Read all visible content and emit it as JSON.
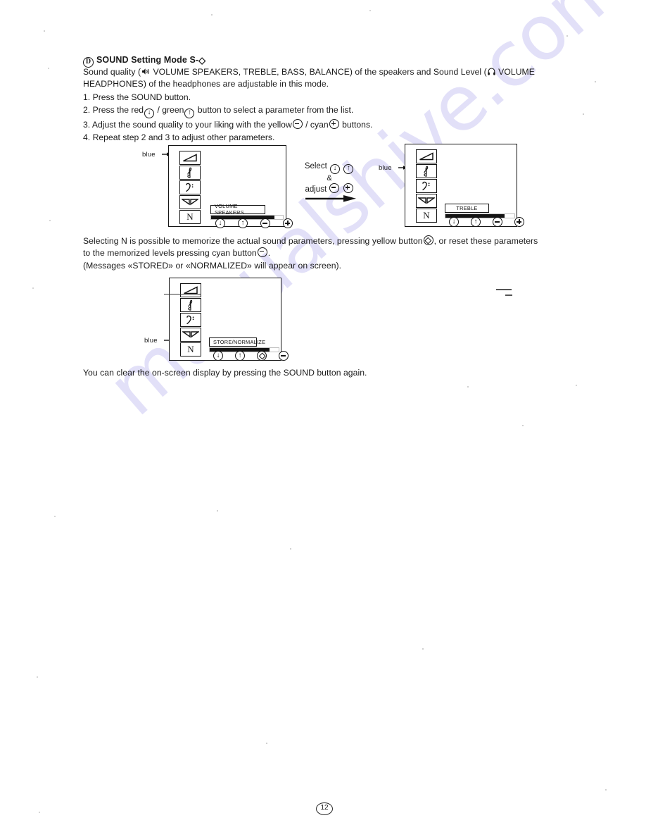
{
  "document": {
    "page_number": "12",
    "watermark": "manualshive.com"
  },
  "heading": {
    "marker": "D",
    "text": "SOUND Setting Mode S-",
    "suffix_icon": "◇"
  },
  "intro": {
    "line1_a": "Sound quality (",
    "speaker_icon": "speaker-icon",
    "line1_b": "VOLUME SPEAKERS, TREBLE, BASS, BALANCE) of the speakers and Sound Level (",
    "headphone_icon": "headphone-icon",
    "line1_c": "VOLUME",
    "line2": "HEADPHONES) of the headphones are adjustable in this mode."
  },
  "steps": [
    {
      "num": "1.",
      "a": "Press the SOUND button.",
      "b": "",
      "c": "",
      "icons": []
    },
    {
      "num": "2.",
      "a": "Press the red",
      "b": "/ green",
      "c": "button to select a parameter from the list."
    },
    {
      "num": "3.",
      "a": "Adjust the sound quality to your liking with the yellow",
      "b": "/ cyan",
      "c": "buttons."
    },
    {
      "num": "4.",
      "a": "Repeat step 2 and 3 to adjust other parameters.",
      "b": "",
      "c": ""
    }
  ],
  "mid_paragraph": {
    "m1_a": "Selecting N is possible to memorize the actual sound parameters, pressing yellow button",
    "m1_b": ", or reset these parameters",
    "m2_a": "to the memorized levels pressing cyan button",
    "m2_b": ".",
    "m3": "(Messages «STORED» or «NORMALIZED» will appear on screen)."
  },
  "bottom_paragraph": {
    "text": "You can clear the on-screen display by pressing the SOUND button again."
  },
  "transition": {
    "select_label": "Select",
    "amp": "&",
    "adjust_label": "adjust"
  },
  "diagrams": [
    {
      "id": "diagram-volume-speakers",
      "blue_label": "blue",
      "blue_target_index": 0,
      "items": [
        {
          "icon": "volume-wedge-icon"
        },
        {
          "icon": "treble-clef-icon"
        },
        {
          "icon": "bass-clef-icon"
        },
        {
          "icon": "balance-icon"
        },
        {
          "icon": "n-memory-icon",
          "letter": "N"
        }
      ],
      "parameter_label": "VOLUME SPEAKERS",
      "bar_fill_percent": 88,
      "buttons": [
        {
          "name": "down-button",
          "glyph": "↓"
        },
        {
          "name": "up-button",
          "glyph": "↑"
        },
        {
          "name": "minus-button",
          "glyph": "minus"
        },
        {
          "name": "plus-button",
          "glyph": "plus"
        }
      ]
    },
    {
      "id": "diagram-treble",
      "blue_label": "blue",
      "blue_target_index": 1,
      "items": [
        {
          "icon": "volume-wedge-icon"
        },
        {
          "icon": "treble-clef-icon"
        },
        {
          "icon": "bass-clef-icon"
        },
        {
          "icon": "balance-icon"
        },
        {
          "icon": "n-memory-icon",
          "letter": "N"
        }
      ],
      "parameter_label": "TREBLE",
      "bar_fill_percent": 86,
      "buttons": [
        {
          "name": "down-button",
          "glyph": "↓"
        },
        {
          "name": "up-button",
          "glyph": "↑"
        },
        {
          "name": "minus-button",
          "glyph": "minus"
        },
        {
          "name": "plus-button",
          "glyph": "plus"
        }
      ]
    },
    {
      "id": "diagram-store-normalize",
      "blue_label": "blue",
      "blue_target_index": 4,
      "items": [
        {
          "icon": "volume-wedge-icon"
        },
        {
          "icon": "treble-clef-icon"
        },
        {
          "icon": "bass-clef-icon"
        },
        {
          "icon": "balance-icon"
        },
        {
          "icon": "n-memory-icon",
          "letter": "N"
        }
      ],
      "parameter_label": "STORE/NORMALIZE",
      "bar_fill_percent": 87,
      "buttons": [
        {
          "name": "down-button",
          "glyph": "↓"
        },
        {
          "name": "up-button",
          "glyph": "↑"
        },
        {
          "name": "store-diamond-button",
          "glyph": "diamond"
        },
        {
          "name": "minus-button",
          "glyph": "minus"
        }
      ]
    }
  ]
}
